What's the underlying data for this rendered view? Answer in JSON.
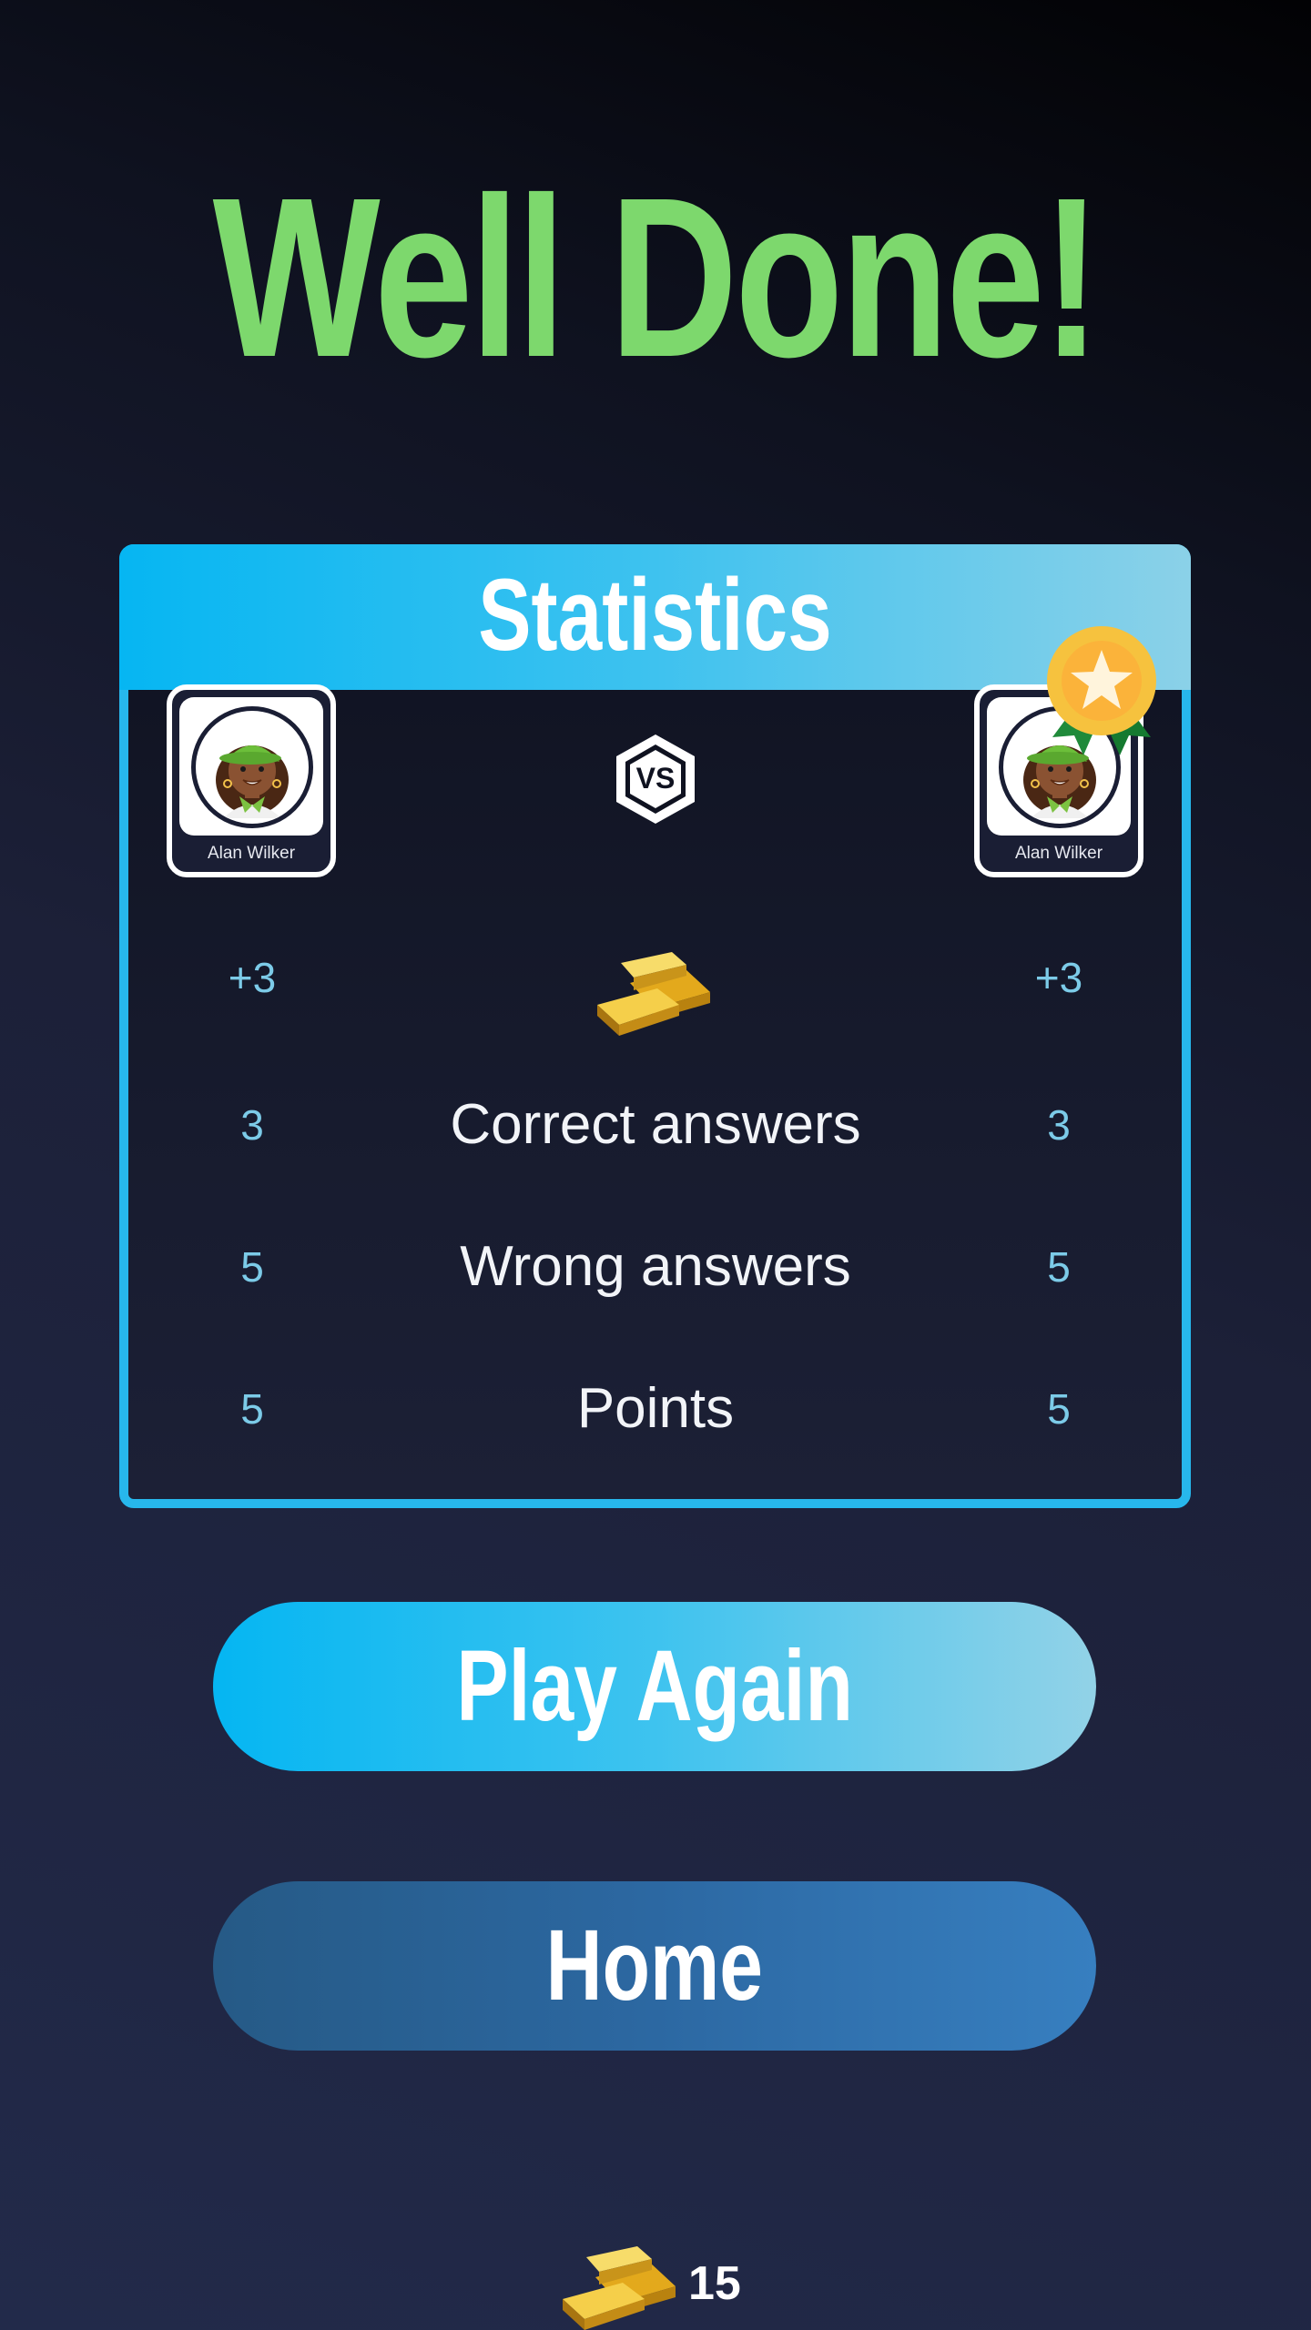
{
  "title": "Well Done!",
  "statistics": {
    "header": "Statistics",
    "vs_label": "VS",
    "player_left": {
      "name": "Alan Wilker",
      "gold": "+3"
    },
    "player_right": {
      "name": "Alan Wilker",
      "gold": "+3",
      "badge_icon": "winner-medal-icon"
    },
    "rows": [
      {
        "label": "Correct answers",
        "left": "3",
        "right": "3"
      },
      {
        "label": "Wrong answers",
        "left": "5",
        "right": "5"
      },
      {
        "label": "Points",
        "left": "5",
        "right": "5"
      }
    ]
  },
  "buttons": {
    "play_again": "Play Again",
    "home": "Home"
  },
  "footer": {
    "coins": "15"
  },
  "colors": {
    "title_green": "#7dd86d",
    "accent_cyan": "#06b6f2",
    "home_blue": "#2c68a2",
    "stat_value": "#7ccbe8"
  }
}
